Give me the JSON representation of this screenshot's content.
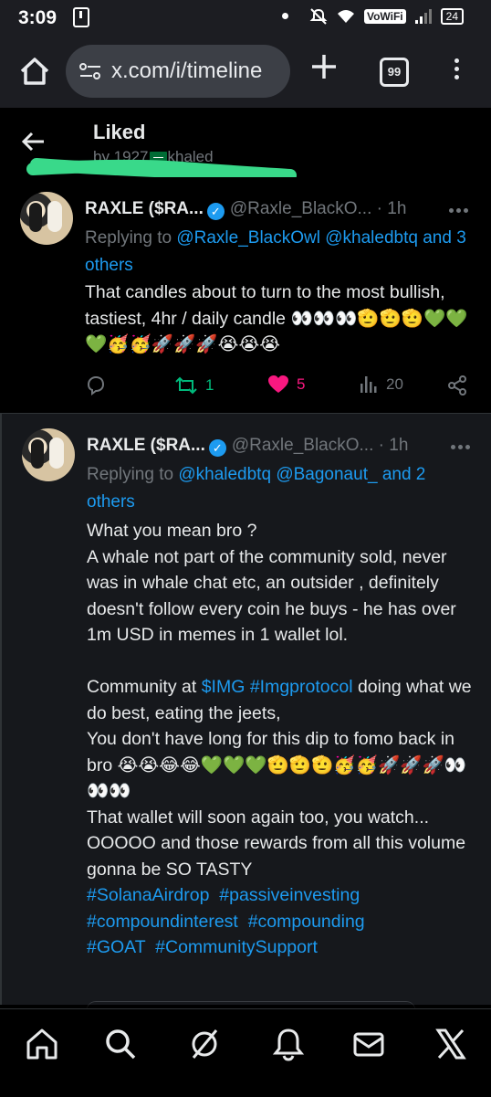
{
  "status_bar": {
    "time": "3:09",
    "network_label": "VoWiFi",
    "battery": "24"
  },
  "browser": {
    "url": "x.com/i/timeline",
    "tab_count": "99"
  },
  "header": {
    "title": "Liked",
    "subtitle_prefix": "by 1927",
    "subtitle_suffix": "khaled"
  },
  "tweets": [
    {
      "name": "RAXLE ($RA...",
      "handle": "@Raxle_BlackO...",
      "separator": "·",
      "time": "1h",
      "replying_prefix": "Replying to ",
      "mention_1": "@Raxle_BlackOwl",
      "mention_2": "@khaledbtq",
      "and_others": "and 3 others",
      "text": "That candles about to turn to the most bullish, tastiest, 4hr / daily candle 👀👀👀🫡🫡🫡💚💚💚🥳🥳🚀🚀🚀😭😭😭",
      "retweets": "1",
      "likes": "5",
      "views": "20"
    },
    {
      "name": "RAXLE ($RA...",
      "handle": "@Raxle_BlackO...",
      "separator": "·",
      "time": "1h",
      "replying_prefix": "Replying to ",
      "mention_1": "@khaledbtq",
      "mention_2": "@Bagonaut_",
      "and_others": "and 2 others",
      "text_part1": "What you mean bro ?\nA whale not part of the community sold, never was in whale chat etc, an outsider , definitely doesn't follow every coin he buys - he has over 1m USD in memes in 1 wallet lol.\n\nCommunity at ",
      "cashtag": "$IMG",
      "hashtag_img": "#Imgprotocol",
      "text_part2": " doing what we do best, eating the jeets,\nYou don't have long for this dip to fomo back in bro 😭😭😂😂💚💚💚🫡🫡🫡🥳🥳🚀🚀🚀👀👀👀\nThat wallet will soon again too, you watch... OOOOO and those rewards from all this volume gonna be SO TASTY\n",
      "hashtags": [
        "#SolanaAirdrop",
        "#passiveinvesting",
        "#compoundinterest",
        "#compounding",
        "#GOAT",
        "#CommunitySupport"
      ]
    }
  ],
  "icons": {
    "status": [
      "download-icon",
      "mute-icon",
      "wifi-icon",
      "signal-icon",
      "battery-icon"
    ],
    "browser": [
      "home-icon",
      "tune-icon",
      "plus-icon",
      "tabs-icon",
      "more-vert-icon"
    ],
    "tweet_actions": [
      "reply-icon",
      "retweet-icon",
      "heart-icon",
      "views-icon",
      "share-icon"
    ],
    "nav": [
      "home-icon",
      "search-icon",
      "grok-icon",
      "notifications-icon",
      "messages-icon",
      "x-logo-icon"
    ]
  },
  "colors": {
    "accent": "#1d9bf0",
    "retweet": "#00ba7c",
    "like": "#f91880",
    "muted": "#71767b",
    "scribble": "#39d98a"
  }
}
